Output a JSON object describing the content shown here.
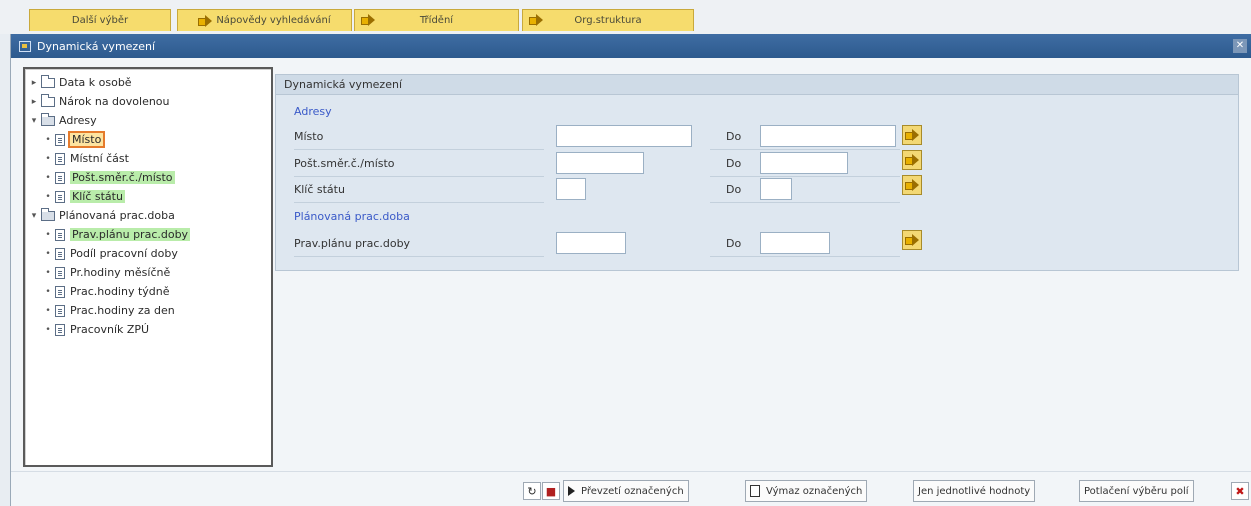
{
  "top_tabs": [
    {
      "label": "Další výběr",
      "has_icon": false
    },
    {
      "label": "Nápovědy vyhledávání",
      "has_icon": true
    },
    {
      "label": "Třídění",
      "has_icon": true
    },
    {
      "label": "Org.struktura",
      "has_icon": true
    }
  ],
  "dialog": {
    "title": "Dynamická vymezení",
    "close_icon": "close-icon"
  },
  "tree": {
    "nodes": [
      {
        "label": "Data k osobě",
        "level": 1,
        "type": "folder",
        "expanded": false
      },
      {
        "label": "Nárok na dovolenou",
        "level": 1,
        "type": "folder",
        "expanded": false
      },
      {
        "label": "Adresy",
        "level": 1,
        "type": "folder",
        "expanded": true
      },
      {
        "label": "Místo",
        "level": 2,
        "type": "doc",
        "highlight": "selected"
      },
      {
        "label": "Místní část",
        "level": 2,
        "type": "doc",
        "highlight": "none"
      },
      {
        "label": "Pošt.směr.č./místo",
        "level": 2,
        "type": "doc",
        "highlight": "green"
      },
      {
        "label": "Klíč státu",
        "level": 2,
        "type": "doc",
        "highlight": "green"
      },
      {
        "label": "Plánovaná prac.doba",
        "level": 1,
        "type": "folder",
        "expanded": true
      },
      {
        "label": "Prav.plánu prac.doby",
        "level": 2,
        "type": "doc",
        "highlight": "green"
      },
      {
        "label": "Podíl pracovní doby",
        "level": 2,
        "type": "doc",
        "highlight": "none"
      },
      {
        "label": "Pr.hodiny měsíčně",
        "level": 2,
        "type": "doc",
        "highlight": "none"
      },
      {
        "label": "Prac.hodiny týdně",
        "level": 2,
        "type": "doc",
        "highlight": "none"
      },
      {
        "label": "Prac.hodiny za den",
        "level": 2,
        "type": "doc",
        "highlight": "none"
      },
      {
        "label": "Pracovník ZPÚ",
        "level": 2,
        "type": "doc",
        "highlight": "none"
      }
    ]
  },
  "form": {
    "header": "Dynamická vymezení",
    "sections": [
      {
        "title": "Adresy",
        "rows": [
          {
            "label": "Místo",
            "from_value": "",
            "to_label": "Do",
            "to_value": ""
          },
          {
            "label": "Pošt.směr.č./místo",
            "from_value": "",
            "to_label": "Do",
            "to_value": ""
          },
          {
            "label": "Klíč státu",
            "from_value": "",
            "to_label": "Do",
            "to_value": ""
          }
        ]
      },
      {
        "title": "Plánovaná prac.doba",
        "rows": [
          {
            "label": "Prav.plánu prac.doby",
            "from_value": "",
            "to_label": "Do",
            "to_value": ""
          }
        ]
      }
    ]
  },
  "bottom_toolbar": {
    "icons": [
      "refresh-icon",
      "save-icon"
    ],
    "buttons": [
      {
        "label": "Převzetí označených",
        "icon": "play-icon"
      },
      {
        "label": "Výmaz označených",
        "icon": "delete-icon"
      },
      {
        "label": "Jen jednotlivé hodnoty",
        "icon": ""
      },
      {
        "label": "Potlačení výběru polí",
        "icon": ""
      }
    ],
    "cancel_icon": "cancel-icon"
  },
  "colors": {
    "title_bar": "#2d5a8e",
    "tab_yellow": "#f6dc6d",
    "tree_selected_outline": "#e57b2c",
    "tree_green_highlight": "#b9ecaa",
    "section_title": "#3a5ac8"
  }
}
